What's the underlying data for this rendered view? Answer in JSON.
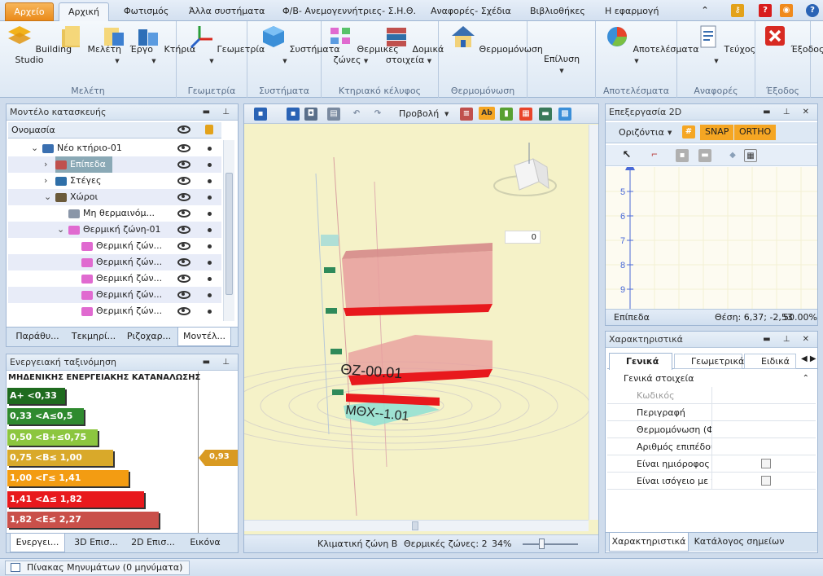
{
  "menu": {
    "file": "Αρχείο",
    "tabs": [
      "Αρχική",
      "Φωτισμός",
      "Άλλα συστήματα",
      "Φ/Β- Ανεμογεννήτριες- Σ.Η.Θ.",
      "Αναφορές- Σχέδια",
      "Βιβλιοθήκες",
      "Η εφαρμογή"
    ]
  },
  "ribbon": {
    "building_studio": "Building\nStudio",
    "meleti": "Μελέτη",
    "ergo": "Έργο",
    "ktiria": "Κτήρια",
    "geometria": "Γεωμετρία",
    "systimata": "Συστήματα",
    "thermikes_zones": "Θερμικές\nζώνες",
    "domika_stoixeia": "Δομικά\nστοιχεία",
    "thermomonosi": "Θερμομόνωση",
    "epilysi": "Επίλυση",
    "apotelesmata": "Αποτελέσματα",
    "teuxos": "Τεύχος",
    "exodos": "Έξοδος",
    "groups": {
      "meleti": "Μελέτη",
      "geometria": "Γεωμετρία",
      "systimata": "Συστήματα",
      "ktiriako": "Κτηριακό κέλυφος",
      "thermomonosi": "Θερμομόνωση",
      "apotelesmata": "Αποτελέσματα",
      "anafores": "Αναφορές",
      "exodos": "Έξοδος"
    }
  },
  "model_panel": {
    "title": "Μοντέλο κατασκευής",
    "col_name": "Ονομασία",
    "items": [
      {
        "label": "Νέο κτήριο-01",
        "indent": 0,
        "icon": "building-icon",
        "color": "#3a6fb0",
        "expander": "⌄"
      },
      {
        "label": "Επίπεδα",
        "indent": 1,
        "icon": "layers-icon",
        "color": "#c0504d",
        "expander": "›",
        "selected": true
      },
      {
        "label": "Στέγες",
        "indent": 1,
        "icon": "roof-icon",
        "color": "#2f6fa8",
        "expander": "›"
      },
      {
        "label": "Χώροι",
        "indent": 1,
        "icon": "rooms-icon",
        "color": "#6b5a3a",
        "expander": "⌄"
      },
      {
        "label": "Μη θερμαινόμ...",
        "indent": 2,
        "icon": "unheated-space-icon",
        "color": "#8a96a8",
        "expander": ""
      },
      {
        "label": "Θερμική ζώνη-01",
        "indent": 2,
        "icon": "thermal-zone-icon",
        "color": "#e06ad0",
        "expander": "⌄"
      },
      {
        "label": "Θερμική ζών...",
        "indent": 3,
        "icon": "thermal-zone-icon",
        "color": "#e06ad0",
        "expander": ""
      },
      {
        "label": "Θερμική ζών...",
        "indent": 3,
        "icon": "thermal-zone-icon",
        "color": "#e06ad0",
        "expander": ""
      },
      {
        "label": "Θερμική ζών...",
        "indent": 3,
        "icon": "thermal-zone-icon",
        "color": "#e06ad0",
        "expander": ""
      },
      {
        "label": "Θερμική ζών...",
        "indent": 3,
        "icon": "thermal-zone-icon",
        "color": "#e06ad0",
        "expander": ""
      },
      {
        "label": "Θερμική ζών...",
        "indent": 3,
        "icon": "thermal-zone-icon",
        "color": "#e06ad0",
        "expander": ""
      }
    ],
    "tabs": [
      "Παράθυ...",
      "Τεκμηρί...",
      "Ριζοχαρ...",
      "Μοντέλ..."
    ]
  },
  "energy_panel": {
    "title": "Ενεργειακή ταξινόμηση",
    "heading": "ΜΗΔΕΝΙΚΗΣ ΕΝΕΡΓΕΙΑΚΗΣ ΚΑΤΑΝΑΛΩΣΗΣ",
    "classes": [
      {
        "label": "A+ <0,33",
        "color": "#1f6b1f",
        "fill": 0.3
      },
      {
        "label": "0,33 <A≤0,5",
        "color": "#2f8a2f",
        "fill": 0.4
      },
      {
        "label": "0,50 <B+≤0,75",
        "color": "#8cc63f",
        "fill": 0.47
      },
      {
        "label": "0,75 <B≤ 1,00",
        "color": "#d9a92a",
        "fill": 0.55
      },
      {
        "label": "1,00 <Γ≤ 1,41",
        "color": "#f39c12",
        "fill": 0.63
      },
      {
        "label": "1,41 <Δ≤ 1,82",
        "color": "#e8191d",
        "fill": 0.71
      },
      {
        "label": "1,82 <E≤ 2,27",
        "color": "#c9504a",
        "fill": 0.79
      }
    ],
    "indicator": "0,93",
    "tabs": [
      "Ενεργει...",
      "3D Επισ...",
      "2D Επισ...",
      "Εικόνα"
    ]
  },
  "viewport": {
    "view_label": "Προβολή",
    "angle_value": "0",
    "zone_label": "ΘZ-00.01",
    "space_label": "ΜΘΧ--1.01",
    "status_climate": "Κλιματική ζώνη Β",
    "status_zones": "Θερμικές ζώνες: 2",
    "status_zoom": "34%"
  },
  "edit2d": {
    "title": "Επεξεργασία 2D",
    "mode": "Οριζόντια",
    "snap": "SNAP",
    "ortho": "ORTHO",
    "ticks": [
      "5",
      "6",
      "7",
      "8",
      "9"
    ],
    "status_levels": "Επίπεδα",
    "status_pos": "Θέση: 6,37; -2,53",
    "status_zoom": "50.00%"
  },
  "props": {
    "title": "Χαρακτηριστικά",
    "tabs": [
      "Γενικά",
      "Γεωμετρικά",
      "Ειδικά"
    ],
    "section": "Γενικά στοιχεία",
    "rows": [
      {
        "label": "Κωδικός",
        "disabled": true,
        "check": false
      },
      {
        "label": "Περιγραφή",
        "disabled": false,
        "check": false
      },
      {
        "label": "Θερμομόνωση (Φ",
        "disabled": false,
        "check": false
      },
      {
        "label": "Αριθμός επιπέδου",
        "disabled": false,
        "check": false
      },
      {
        "label": "Είναι ημιόροφος",
        "disabled": false,
        "check": true
      },
      {
        "label": "Είναι ισόγειο με π",
        "disabled": false,
        "check": true
      }
    ],
    "bottom_tabs": [
      "Χαρακτηριστικά",
      "Κατάλογος σημείων"
    ]
  },
  "messages": {
    "label": "Πίνακας Μηνυμάτων (0 μηνύματα)"
  }
}
